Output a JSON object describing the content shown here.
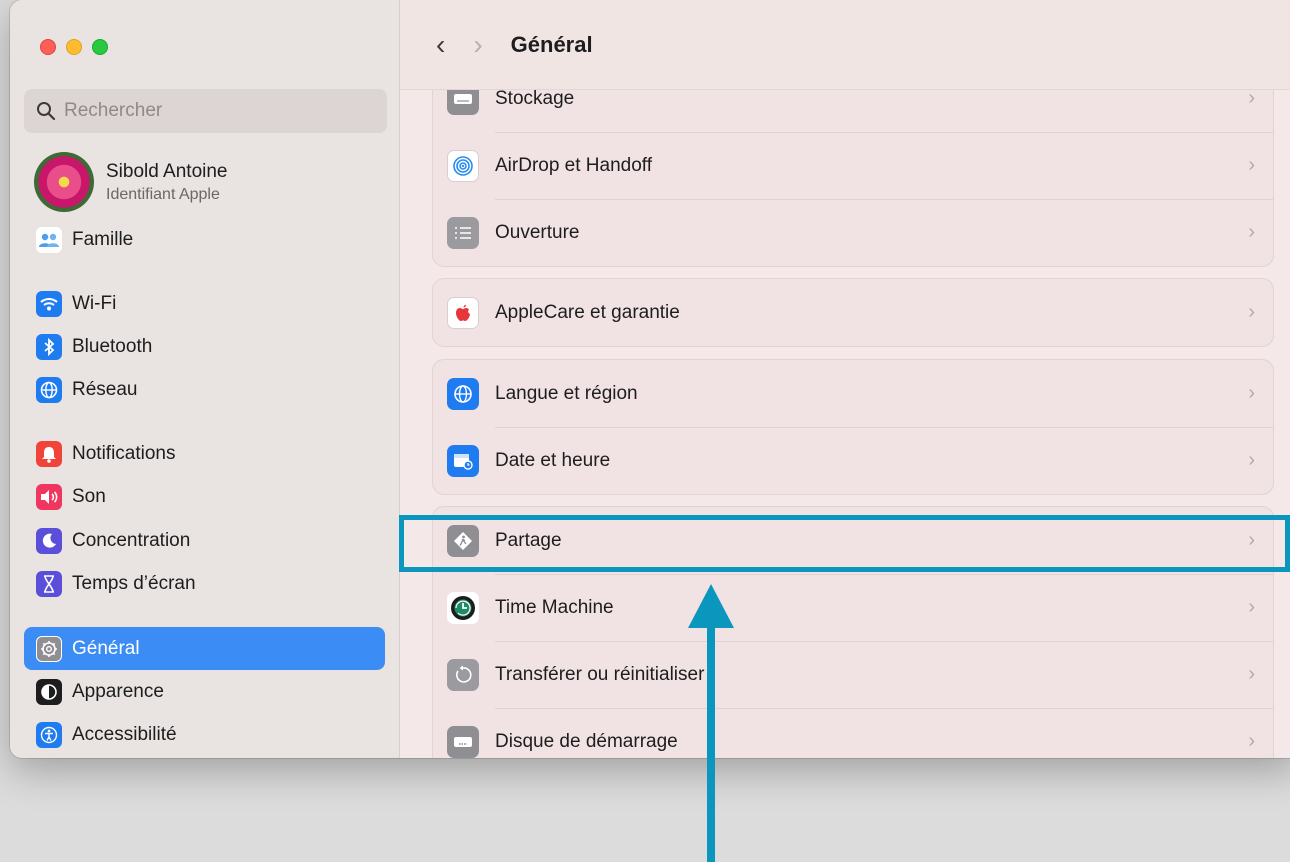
{
  "window": {
    "title": "Général",
    "nav_back": "‹",
    "nav_forward": "›"
  },
  "search": {
    "placeholder": "Rechercher"
  },
  "profile": {
    "name": "Sibold Antoine",
    "subtitle": "Identifiant Apple"
  },
  "sidebar": {
    "items": [
      {
        "label": "Famille",
        "icon": "family-icon",
        "color": "#4a9df0"
      },
      {
        "label": "Wi-Fi",
        "icon": "wifi-icon",
        "color": "#1f7cf0"
      },
      {
        "label": "Bluetooth",
        "icon": "bluetooth-icon",
        "color": "#1f7cf0"
      },
      {
        "label": "Réseau",
        "icon": "globe-icon",
        "color": "#1f7cf0"
      },
      {
        "label": "Notifications",
        "icon": "bell-icon",
        "color": "#f0443a"
      },
      {
        "label": "Son",
        "icon": "speaker-icon",
        "color": "#f0365f"
      },
      {
        "label": "Concentration",
        "icon": "moon-icon",
        "color": "#5b4fd9"
      },
      {
        "label": "Temps d’écran",
        "icon": "hourglass-icon",
        "color": "#5b4fd9"
      },
      {
        "label": "Général",
        "icon": "gear-icon",
        "color": "#8e8e93",
        "active": true
      },
      {
        "label": "Apparence",
        "icon": "appearance-icon",
        "color": "#1d1d1f"
      },
      {
        "label": "Accessibilité",
        "icon": "accessibility-icon",
        "color": "#1f7cf0"
      }
    ]
  },
  "groups": [
    {
      "rows": [
        {
          "label": "Stockage",
          "icon": "storage-icon",
          "color": "#8e8e93"
        },
        {
          "label": "AirDrop et Handoff",
          "icon": "airdrop-icon",
          "color": "#ffffff"
        },
        {
          "label": "Ouverture",
          "icon": "list-icon",
          "color": "#9a9a9f"
        }
      ]
    },
    {
      "rows": [
        {
          "label": "AppleCare et garantie",
          "icon": "apple-icon",
          "color": "#ffffff"
        }
      ]
    },
    {
      "rows": [
        {
          "label": "Langue et région",
          "icon": "globe-icon",
          "color": "#1f7cf0"
        },
        {
          "label": "Date et heure",
          "icon": "calendar-clock-icon",
          "color": "#1f7cf0"
        }
      ]
    },
    {
      "rows": [
        {
          "label": "Partage",
          "icon": "sharing-icon",
          "color": "#8e8e93"
        },
        {
          "label": "Time Machine",
          "icon": "time-machine-icon",
          "color": "#ffffff"
        },
        {
          "label": "Transférer ou réinitialiser",
          "icon": "reset-icon",
          "color": "#9a9a9f"
        },
        {
          "label": "Disque de démarrage",
          "icon": "disk-icon",
          "color": "#8e8e93"
        }
      ]
    }
  ],
  "chevron": "›",
  "annotation": {
    "color": "#0b96be",
    "target": "Partage"
  }
}
